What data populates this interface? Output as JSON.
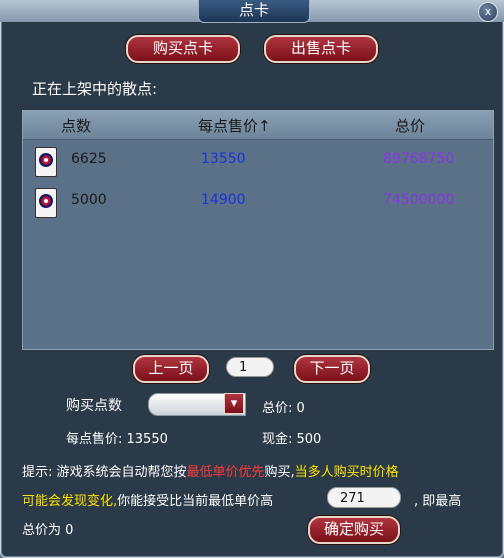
{
  "window": {
    "title": "点卡",
    "close_glyph": "x"
  },
  "top_buttons": {
    "buy": "购买点卡",
    "sell": "出售点卡"
  },
  "section_label": "正在上架中的散点:",
  "table": {
    "headers": {
      "count": "点数",
      "price": "每点售价",
      "sort_arrow": "↑",
      "total": "总价"
    },
    "rows": [
      {
        "icon": "point-card-icon",
        "count": "6625",
        "price": "13550",
        "total": "89768750"
      },
      {
        "icon": "point-card-icon",
        "count": "5000",
        "price": "14900",
        "total": "74500000"
      }
    ]
  },
  "pager": {
    "prev": "上一页",
    "page": "1",
    "next": "下一页"
  },
  "buy_form": {
    "qty_label": "购买点数",
    "qty_value": "",
    "total_label": "总价: 0",
    "unit_label": "每点售价: 13550",
    "cash_label": "现金: 500"
  },
  "hint": {
    "p1": "提示: 游戏系统会自动帮您按",
    "p2": "最低单价优先",
    "p3": "购买,",
    "p4": "当多人购买时价格",
    "p5": "可能会发现变化,",
    "p6": "你能接受比当前最低单价高",
    "min_value": "271",
    "p7": ", 即最高",
    "p8": "总价为 0"
  },
  "confirm_button": "确定购买",
  "colors": {
    "price_blue": "#1b33e0",
    "total_purple": "#8a35e6",
    "warning_red": "#ff3a3a",
    "warning_yellow": "#ffe300",
    "button_red": "#9a1f28"
  }
}
